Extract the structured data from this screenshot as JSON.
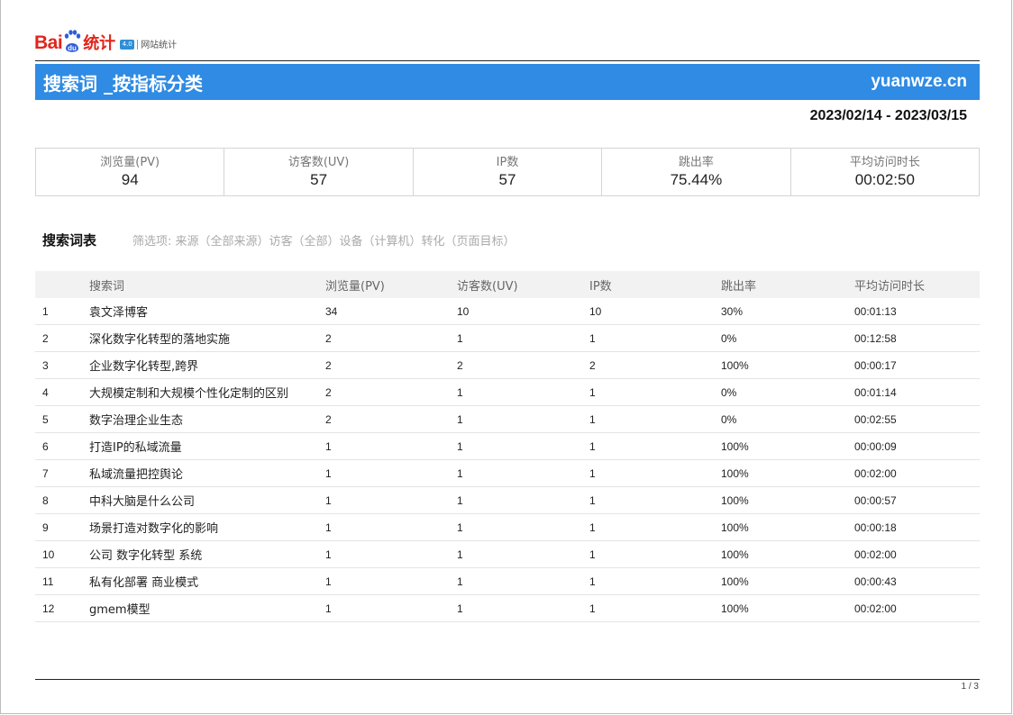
{
  "logo": {
    "bai": "Bai",
    "du": "du",
    "tongji": "统计",
    "badge": "4.0",
    "site_label": "网站统计"
  },
  "header": {
    "title": "搜索词 _按指标分类",
    "site": "yuanwze.cn",
    "date_range": "2023/02/14 - 2023/03/15"
  },
  "summary": [
    {
      "label": "浏览量(PV)",
      "value": "94"
    },
    {
      "label": "访客数(UV)",
      "value": "57"
    },
    {
      "label": "IP数",
      "value": "57"
    },
    {
      "label": "跳出率",
      "value": "75.44%"
    },
    {
      "label": "平均访问时长",
      "value": "00:02:50"
    }
  ],
  "section": {
    "title": "搜索词表",
    "filters": "筛选项:  来源（全部来源）访客（全部）设备（计算机）转化（页面目标）"
  },
  "table": {
    "headers": [
      "",
      "搜索词",
      "浏览量(PV)",
      "访客数(UV)",
      "IP数",
      "跳出率",
      "平均访问时长"
    ],
    "rows": [
      [
        "1",
        "袁文泽博客",
        "34",
        "10",
        "10",
        "30%",
        "00:01:13"
      ],
      [
        "2",
        "深化数字化转型的落地实施",
        "2",
        "1",
        "1",
        "0%",
        "00:12:58"
      ],
      [
        "3",
        "企业数字化转型,跨界",
        "2",
        "2",
        "2",
        "100%",
        "00:00:17"
      ],
      [
        "4",
        "大规模定制和大规模个性化定制的区别",
        "2",
        "1",
        "1",
        "0%",
        "00:01:14"
      ],
      [
        "5",
        "数字治理企业生态",
        "2",
        "1",
        "1",
        "0%",
        "00:02:55"
      ],
      [
        "6",
        "打造IP的私域流量",
        "1",
        "1",
        "1",
        "100%",
        "00:00:09"
      ],
      [
        "7",
        "私域流量把控舆论",
        "1",
        "1",
        "1",
        "100%",
        "00:02:00"
      ],
      [
        "8",
        "中科大脑是什么公司",
        "1",
        "1",
        "1",
        "100%",
        "00:00:57"
      ],
      [
        "9",
        "场景打造对数字化的影响",
        "1",
        "1",
        "1",
        "100%",
        "00:00:18"
      ],
      [
        "10",
        "公司 数字化转型 系统",
        "1",
        "1",
        "1",
        "100%",
        "00:02:00"
      ],
      [
        "11",
        "私有化部署 商业模式",
        "1",
        "1",
        "1",
        "100%",
        "00:00:43"
      ],
      [
        "12",
        "gmem模型",
        "1",
        "1",
        "1",
        "100%",
        "00:02:00"
      ]
    ]
  },
  "footer": {
    "page": "1 / 3"
  },
  "colors": {
    "title_bar": "#2f8be3",
    "logo_red": "#e1251b",
    "logo_blue": "#2e5fd6"
  },
  "icons": {
    "logo_paw": "baidu-paw-icon"
  }
}
